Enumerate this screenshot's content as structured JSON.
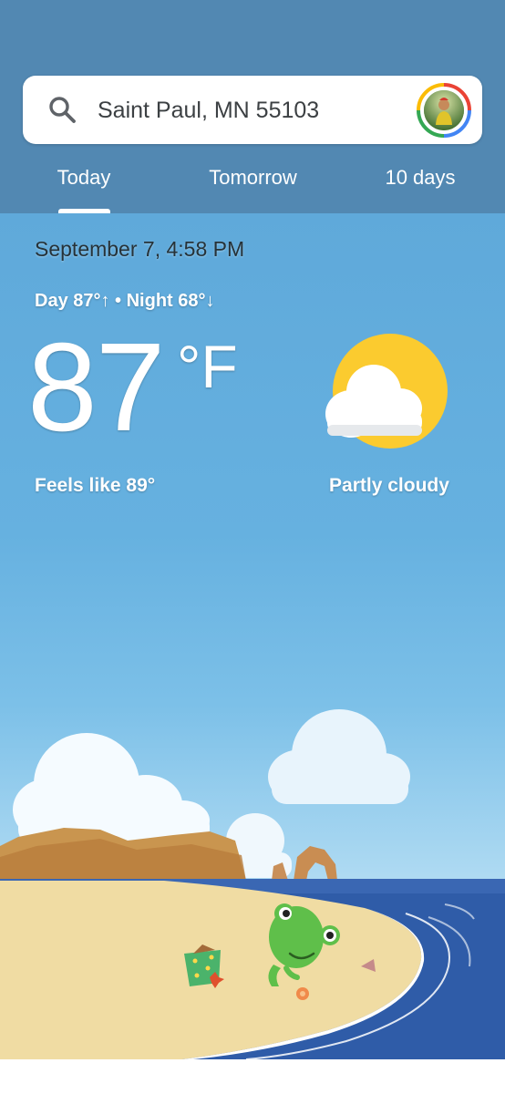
{
  "search": {
    "location": "Saint Paul, MN 55103",
    "icon": "search-icon"
  },
  "tabs": [
    {
      "label": "Today",
      "selected": true
    },
    {
      "label": "Tomorrow",
      "selected": false
    },
    {
      "label": "10 days",
      "selected": false
    }
  ],
  "weather": {
    "date_time": "September 7, 4:58 PM",
    "day_night": "Day 87°↑ • Night 68°↓",
    "temperature": "87",
    "unit": "°F",
    "feels_like": "Feels like 89°",
    "condition": "Partly cloudy",
    "condition_icon": "partly-cloudy-icon"
  },
  "colors": {
    "header": "#5288b2",
    "sky_top": "#5fa9da",
    "sun": "#fbcb2f",
    "sea": "#2f5ca8",
    "sand": "#f0dca3",
    "frog": "#5fbf4a"
  }
}
